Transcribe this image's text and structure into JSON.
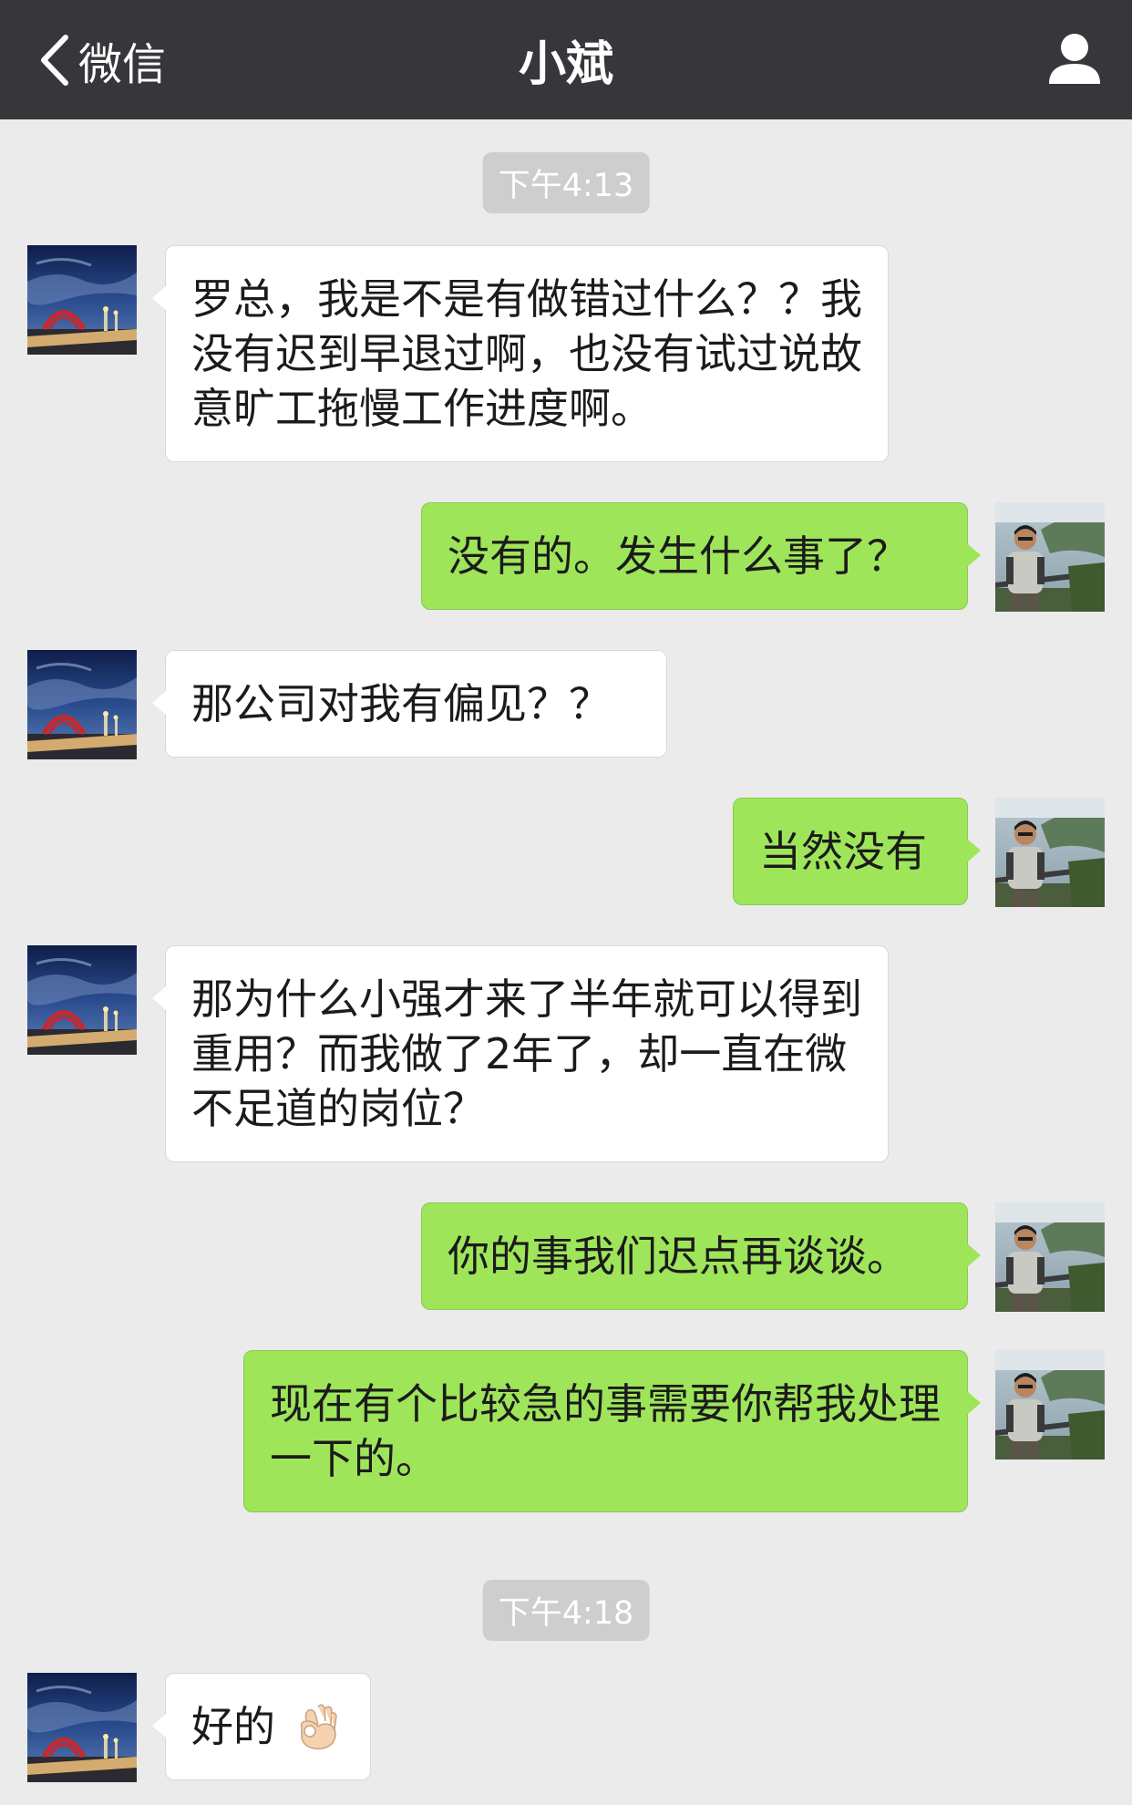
{
  "nav": {
    "back_label": "微信",
    "title": "小斌",
    "back_icon": "chevron-left-icon",
    "profile_icon": "person-icon"
  },
  "timestamps": [
    "下午4:13",
    "下午4:18"
  ],
  "messages": [
    {
      "side": "in",
      "text": "罗总，我是不是有做错过什么？？我没有迟到早退过啊，也没有试过说故意旷工拖慢工作进度啊。"
    },
    {
      "side": "out",
      "text": "没有的。发生什么事了？"
    },
    {
      "side": "in",
      "text": "那公司对我有偏见？？"
    },
    {
      "side": "out",
      "text": "当然没有"
    },
    {
      "side": "in",
      "text": "那为什么小强才来了半年就可以得到重用？而我做了2年了，却一直在微不足道的岗位？"
    },
    {
      "side": "out",
      "text": "你的事我们迟点再谈谈。"
    },
    {
      "side": "out",
      "text": "现在有个比较急的事需要你帮我处理一下的。"
    },
    {
      "side": "in",
      "text": "好的",
      "emoji": "ok-hand-emoji"
    }
  ],
  "colors": {
    "navbar": "#36363b",
    "background": "#ebebeb",
    "incoming_bubble": "#ffffff",
    "outgoing_bubble": "#9fe55a",
    "timestamp_bg": "#cecece"
  }
}
